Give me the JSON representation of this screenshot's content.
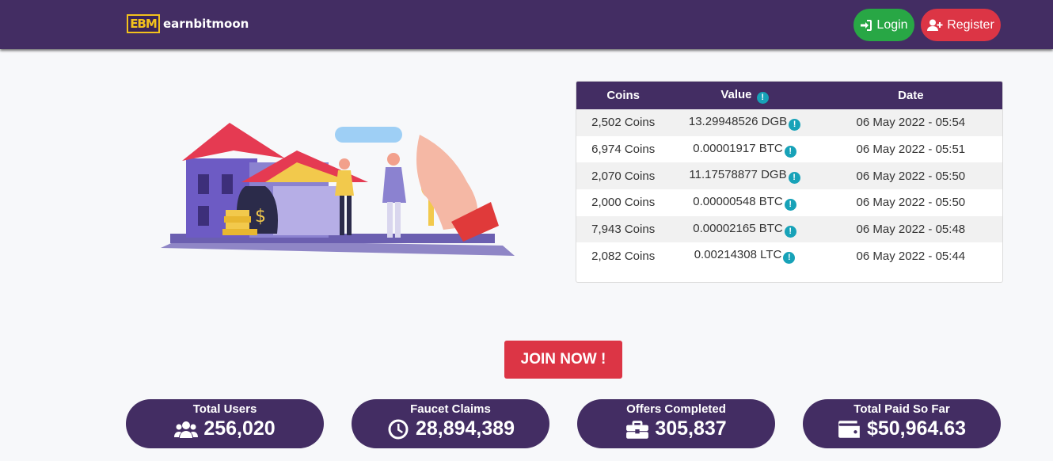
{
  "brand": {
    "logo_text": "EBM",
    "name": "earnbitmoon"
  },
  "nav": {
    "login_label": "Login",
    "register_label": "Register"
  },
  "payouts": {
    "headers": {
      "coins": "Coins",
      "value": "Value",
      "date": "Date"
    },
    "rows": [
      {
        "coins": "2,502 Coins",
        "value": "13.29948526 DGB",
        "date": "06 May 2022 - 05:54"
      },
      {
        "coins": "6,974 Coins",
        "value": "0.00001917 BTC",
        "date": "06 May 2022 - 05:51"
      },
      {
        "coins": "2,070 Coins",
        "value": "11.17578877 DGB",
        "date": "06 May 2022 - 05:50"
      },
      {
        "coins": "2,000 Coins",
        "value": "0.00000548 BTC",
        "date": "06 May 2022 - 05:50"
      },
      {
        "coins": "7,943 Coins",
        "value": "0.00002165 BTC",
        "date": "06 May 2022 - 05:48"
      },
      {
        "coins": "2,082 Coins",
        "value": "0.00214308 LTC",
        "date": "06 May 2022 - 05:44"
      }
    ]
  },
  "join_label": "JOIN NOW !",
  "stats": [
    {
      "label": "Total Users",
      "value": "256,020",
      "icon": "users-icon"
    },
    {
      "label": "Faucet Claims",
      "value": "28,894,389",
      "icon": "clock-icon"
    },
    {
      "label": "Offers Completed",
      "value": "305,837",
      "icon": "briefcase-icon"
    },
    {
      "label": "Total Paid So Far",
      "value": "$50,964.63",
      "icon": "wallet-icon"
    }
  ],
  "colors": {
    "primary": "#432d63",
    "success": "#28a745",
    "danger": "#dc3545",
    "info": "#17a2b8"
  }
}
